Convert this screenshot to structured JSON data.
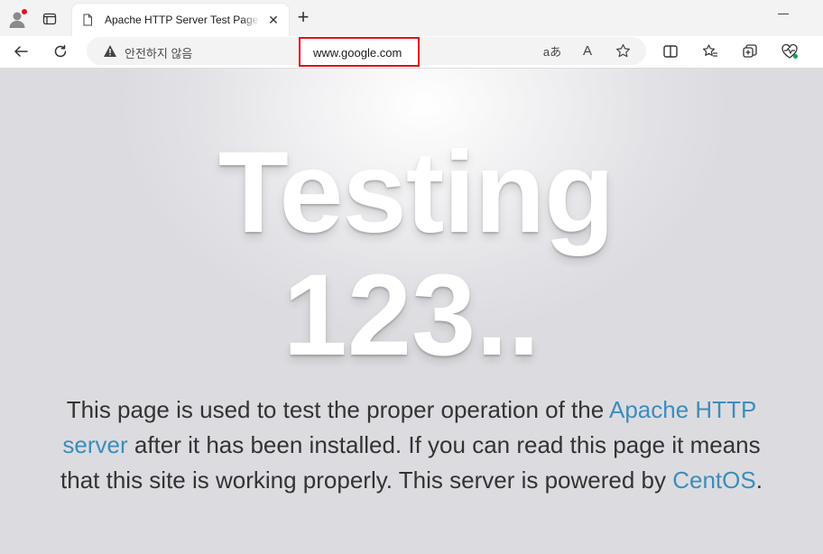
{
  "tab": {
    "title": "Apache HTTP Server Test Page powered by CentOS",
    "close_glyph": "✕"
  },
  "newtab_glyph": "+",
  "addressbar": {
    "security_label": "안전하지 않음",
    "url": "www.google.com",
    "read_aloud_label": "aあ",
    "reader_label": "A"
  },
  "page": {
    "heading_line1": "Testing",
    "heading_line2": "123..",
    "description": {
      "part1": "This page is used to test the proper operation of the",
      "link1": "Apache HTTP server",
      "part2": "after it has been installed. If you can read this page it means that this site is working properly. This server is powered by",
      "link2": "CentOS",
      "part3": "."
    }
  },
  "colors": {
    "link": "#3c8dbc",
    "highlight_box": "#e0101a",
    "notification_dot": "#e81123"
  }
}
